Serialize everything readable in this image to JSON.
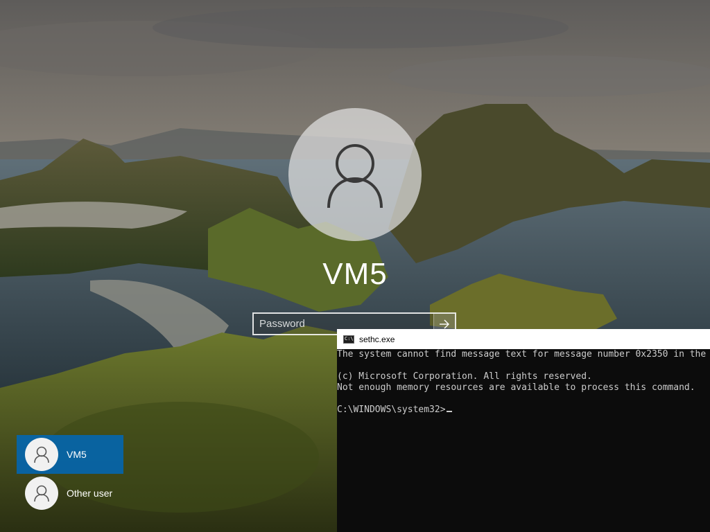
{
  "lock_screen": {
    "username": "VM5",
    "password_placeholder": "Password",
    "users": [
      {
        "label": "VM5",
        "selected": true
      },
      {
        "label": "Other user",
        "selected": false
      }
    ],
    "accent_color": "#0067b8"
  },
  "console": {
    "title": "sethc.exe",
    "lines": [
      "The system cannot find message text for message number 0x2350 in the",
      "",
      "(c) Microsoft Corporation. All rights reserved.",
      "Not enough memory resources are available to process this command.",
      "",
      "C:\\WINDOWS\\system32>"
    ],
    "background": "#0c0c0c",
    "text_color": "#cccccc"
  },
  "icons": {
    "user_avatar": "person-icon",
    "submit": "arrow-right-icon",
    "console": "cmd-icon"
  }
}
